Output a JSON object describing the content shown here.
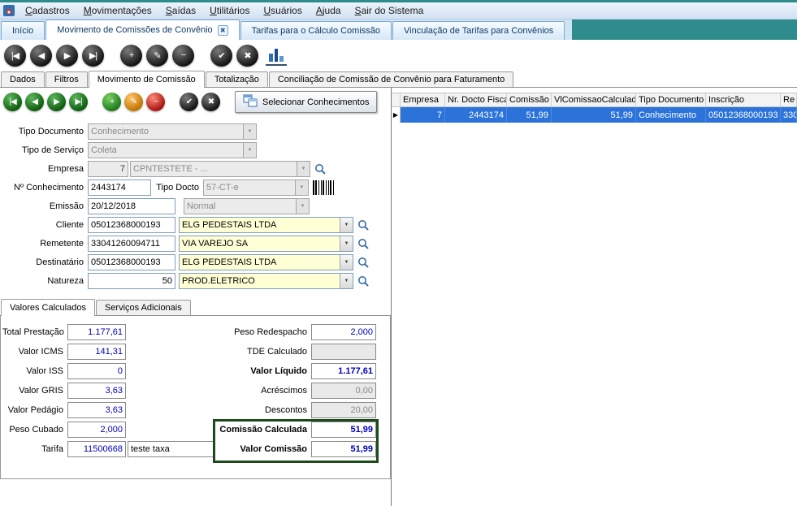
{
  "app": {
    "menu_items": [
      "Cadastros",
      "Movimentações",
      "Saídas",
      "Utilitários",
      "Usuários",
      "Ajuda",
      "Sair do Sistema"
    ]
  },
  "tabs": {
    "inicio": "Início",
    "movimento": "Movimento de Comissões de Convênio",
    "tarifas": "Tarifas para o Cálculo Comissão",
    "vinculacao": "Vinculação de Tarifas para Convênios"
  },
  "inner_tabs": {
    "dados": "Dados",
    "filtros": "Filtros",
    "movimento": "Movimento de Comissão",
    "totalizacao": "Totalização",
    "conciliacao": "Conciliação de Comissão de Convênio para Faturamento"
  },
  "toolbar": {
    "select_conhecimentos": "Selecionar Conhecimentos"
  },
  "form": {
    "tipo_documento": {
      "label": "Tipo Documento",
      "value": "Conhecimento"
    },
    "tipo_servico": {
      "label": "Tipo de Serviço",
      "value": "Coleta"
    },
    "empresa": {
      "label": "Empresa",
      "code": "7",
      "name": "CPNTESTETE - ..."
    },
    "n_conhecimento": {
      "label": "Nº Conhecimento",
      "value": "2443174"
    },
    "tipo_docto": {
      "label": "Tipo Docto",
      "value": "57-CT-e"
    },
    "emissao": {
      "label": "Emissão",
      "value": "20/12/2018",
      "tipo": "Normal"
    },
    "cliente": {
      "label": "Cliente",
      "code": "05012368000193",
      "name": "ELG PEDESTAIS LTDA"
    },
    "remetente": {
      "label": "Remetente",
      "code": "33041260094711",
      "name": "VIA VAREJO SA"
    },
    "destinatario": {
      "label": "Destinatário",
      "code": "05012368000193",
      "name": "ELG PEDESTAIS LTDA"
    },
    "natureza": {
      "label": "Natureza",
      "code": "50",
      "name": "PROD.ELETRICO"
    }
  },
  "value_tabs": {
    "valores_calculados": "Valores Calculados",
    "servicos_adicionais": "Serviços Adicionais"
  },
  "values": {
    "total_prestacao": {
      "label": "Total Prestação",
      "value": "1.177,61"
    },
    "valor_icms": {
      "label": "Valor ICMS",
      "value": "141,31"
    },
    "valor_iss": {
      "label": "Valor ISS",
      "value": "0"
    },
    "valor_gris": {
      "label": "Valor GRIS",
      "value": "3,63"
    },
    "valor_pedagio": {
      "label": "Valor Pedágio",
      "value": "3,63"
    },
    "peso_cubado": {
      "label": "Peso Cubado",
      "value": "2,000"
    },
    "tarifa": {
      "label": "Tarifa",
      "code": "11500668",
      "descricao": "teste taxa"
    },
    "peso_redespacho": {
      "label": "Peso Redespacho",
      "value": "2,000"
    },
    "tde_calculado": {
      "label": "TDE Calculado",
      "value": ""
    },
    "valor_liquido": {
      "label": "Valor Líquido",
      "value": "1.177,61"
    },
    "acrescimos": {
      "label": "Acréscimos",
      "value": "0,00"
    },
    "descontos": {
      "label": "Descontos",
      "value": "20,00"
    },
    "comissao_calculada": {
      "label": "Comissão Calculada",
      "value": "51,99"
    },
    "valor_comissao": {
      "label": "Valor Comissão",
      "value": "51,99"
    }
  },
  "grid": {
    "columns": [
      "Empresa",
      "Nr. Docto Fiscal",
      "Comissão",
      "VlComissaoCalculado",
      "Tipo Documento",
      "Inscrição",
      "Re"
    ],
    "row": {
      "empresa": "7",
      "nr_docto_fiscal": "2443174",
      "comissao": "51,99",
      "vl_comissao_calculado": "51,99",
      "tipo_documento": "Conhecimento",
      "inscricao": "05012368000193",
      "re": "330"
    }
  },
  "icons": {
    "first": "|◀",
    "prev": "◀",
    "next": "▶",
    "last": "▶|",
    "add": "+",
    "edit": "✎",
    "remove": "−",
    "confirm": "✔",
    "cancel": "✖",
    "close": "✖",
    "dropdown": "▼",
    "marker": "▶"
  },
  "colors": {
    "accent_teal": "#2e8c8c",
    "selection_blue": "#2b72d9",
    "highlight_yellow": "#ffffd6",
    "value_blue": "#0000bb",
    "commission_box_green": "#1c4a1c"
  }
}
